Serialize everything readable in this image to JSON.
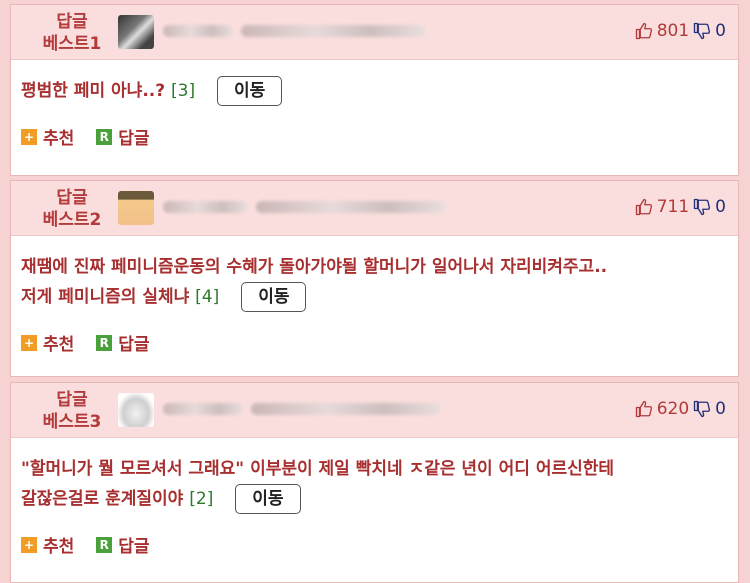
{
  "comments": [
    {
      "rank_line1": "답글",
      "rank_line2": "베스트1",
      "up": "801",
      "down": "0",
      "content_lines": [
        "평범한 페미 아냐..?"
      ],
      "reply_count": "[3]",
      "move_label": "이동",
      "recommend_label": "추천",
      "reply_label": "답글"
    },
    {
      "rank_line1": "답글",
      "rank_line2": "베스트2",
      "up": "711",
      "down": "0",
      "content_lines": [
        "재땜에 진짜 페미니즘운동의 수혜가 돌아가야될 할머니가 일어나서 자리비켜주고..",
        "저게 페미니즘의 실체냐"
      ],
      "reply_count": "[4]",
      "move_label": "이동",
      "recommend_label": "추천",
      "reply_label": "답글"
    },
    {
      "rank_line1": "답글",
      "rank_line2": "베스트3",
      "up": "620",
      "down": "0",
      "content_lines": [
        "\"할머니가 뭘 모르셔서 그래요\" 이부분이 제일 빡치네 ㅈ같은 년이 어디 어르신한테",
        "갈잖은걸로 훈계질이야"
      ],
      "reply_count": "[2]",
      "move_label": "이동",
      "recommend_label": "추천",
      "reply_label": "답글"
    }
  ],
  "icons": {
    "thumb_up": "thumbs-up-icon",
    "thumb_down": "thumbs-down-icon",
    "recommend": "plus-icon",
    "reply": "reply-r-icon"
  },
  "colors": {
    "accent": "#b23a3a",
    "header_bg": "#f9dedd",
    "count_green": "#2d7a2d",
    "down_blue": "#24307a"
  },
  "badges": {
    "plus": "+",
    "r": "R"
  }
}
